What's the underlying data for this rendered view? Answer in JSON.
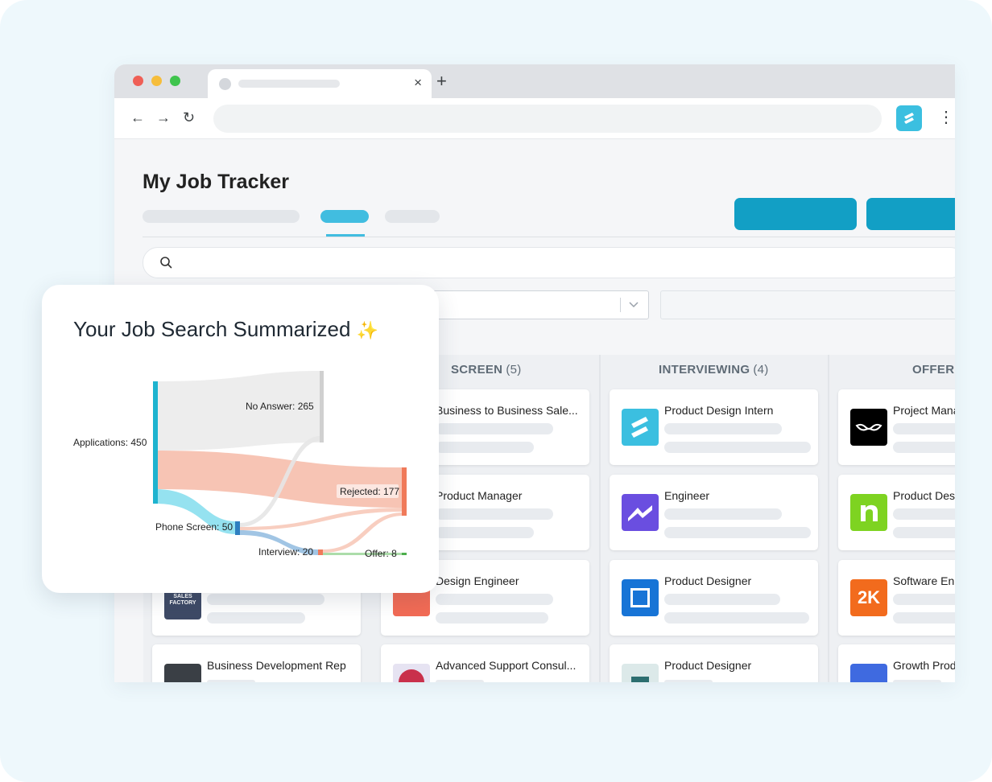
{
  "page": {
    "title": "My Job Tracker"
  },
  "browser": {
    "back_icon": "←",
    "forward_icon": "→",
    "reload_icon": "↻",
    "close_icon": "×",
    "newtab_icon": "+",
    "menu_icon": "⋮"
  },
  "board": {
    "columns": [
      {
        "name": "SCREEN",
        "count": "(5)"
      },
      {
        "name": "INTERVIEWING",
        "count": "(4)"
      },
      {
        "name": "OFFER",
        "count": ""
      }
    ],
    "cards": {
      "col0": [
        "Business Development Rep"
      ],
      "col1": [
        "Business to Business Sale...",
        "Product Manager",
        "Design Engineer",
        "Advanced Support Consul..."
      ],
      "col2": [
        "Product Design Intern",
        "Engineer",
        "Product Designer",
        "Product Designer"
      ],
      "col3": [
        "Project Mana",
        "Product Des",
        "Software En",
        "Growth Prod"
      ]
    },
    "logo_text": {
      "sales_factory": "SALES FACTORY"
    },
    "colors": {
      "accent": "#129fc5",
      "tab_accent": "#41bde0"
    }
  },
  "summary": {
    "title": "Your Job Search Summarized",
    "sparkle": "✨",
    "chart_data": {
      "type": "sankey",
      "nodes": [
        {
          "name": "Applications",
          "value": 450,
          "label": "Applications: 450"
        },
        {
          "name": "No Answer",
          "value": 265,
          "label": "No Answer: 265"
        },
        {
          "name": "Rejected",
          "value": 177,
          "label": "Rejected: 177"
        },
        {
          "name": "Phone Screen",
          "value": 50,
          "label": "Phone Screen: 50"
        },
        {
          "name": "Interview",
          "value": 20,
          "label": "Interview: 20"
        },
        {
          "name": "Offer",
          "value": 8,
          "label": "Offer: 8"
        }
      ],
      "links": [
        {
          "source": "Applications",
          "target": "No Answer",
          "value": 250
        },
        {
          "source": "Applications",
          "target": "Rejected",
          "value": 150
        },
        {
          "source": "Applications",
          "target": "Phone Screen",
          "value": 50
        },
        {
          "source": "Phone Screen",
          "target": "No Answer",
          "value": 15
        },
        {
          "source": "Phone Screen",
          "target": "Rejected",
          "value": 15
        },
        {
          "source": "Phone Screen",
          "target": "Interview",
          "value": 20
        },
        {
          "source": "Interview",
          "target": "Rejected",
          "value": 12
        },
        {
          "source": "Interview",
          "target": "Offer",
          "value": 8
        }
      ],
      "colors": {
        "Applications": "#1eb3cf",
        "No Answer": "#d4d4d4",
        "Rejected": "#f07a5a",
        "Phone Screen": "#2f7fc0",
        "Interview": "#f07a5a",
        "Offer": "#4cae4c"
      }
    }
  }
}
